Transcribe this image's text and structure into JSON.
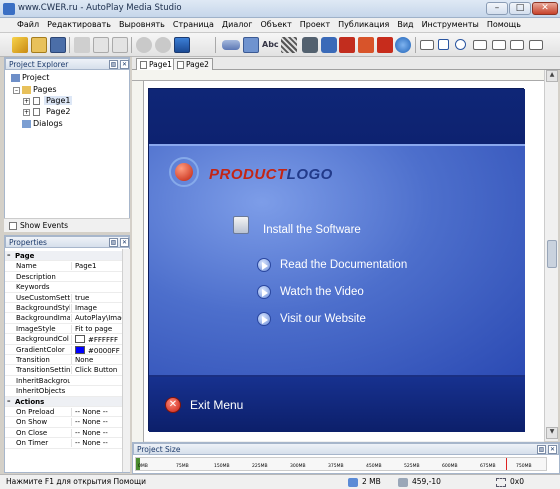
{
  "window": {
    "title": "www.CWER.ru - AutoPlay Media Studio"
  },
  "menu": [
    "Файл",
    "Редактировать",
    "Выровнять",
    "Страница",
    "Диалог",
    "Объект",
    "Проект",
    "Публикация",
    "Вид",
    "Инструменты",
    "Помощь"
  ],
  "explorer": {
    "title": "Project Explorer",
    "items": {
      "project": "Project",
      "pages": "Pages",
      "page1": "Page1",
      "page2": "Page2",
      "dialogs": "Dialogs"
    },
    "show_events": "Show Events"
  },
  "properties": {
    "title": "Properties",
    "section_page": "Page",
    "rows": [
      {
        "k": "Name",
        "v": "Page1"
      },
      {
        "k": "Description",
        "v": ""
      },
      {
        "k": "Keywords",
        "v": ""
      },
      {
        "k": "UseCustomSett",
        "v": "true"
      },
      {
        "k": "BackgroundStyl",
        "v": "Image"
      },
      {
        "k": "BackgroundIma",
        "v": "AutoPlay\\Imag"
      },
      {
        "k": "ImageStyle",
        "v": "Fit to page"
      },
      {
        "k": "BackgroundCol",
        "v": "#FFFFFF"
      },
      {
        "k": "GradientColor",
        "v": "#0000FF"
      },
      {
        "k": "Transition",
        "v": "None"
      },
      {
        "k": "TransitionSettin",
        "v": "Click Button"
      },
      {
        "k": "InheritBackgrou",
        "v": ""
      },
      {
        "k": "InheritObjects",
        "v": ""
      }
    ],
    "section_actions": "Actions",
    "actions": [
      {
        "k": "On Preload",
        "v": "-- None --"
      },
      {
        "k": "On Show",
        "v": "-- None --"
      },
      {
        "k": "On Close",
        "v": "-- None --"
      },
      {
        "k": "On Timer",
        "v": "-- None --"
      }
    ],
    "colors": {
      "background": "#FFFFFF",
      "gradient": "#0000FF"
    }
  },
  "tabs": [
    "Page1",
    "Page2"
  ],
  "page_content": {
    "logo_a": "PRODUCT",
    "logo_b": "LOGO",
    "install": "Install the Software",
    "items": [
      "Read the Documentation",
      "Watch the Video",
      "Visit our Website"
    ],
    "exit": "Exit Menu"
  },
  "project_size": {
    "title": "Project Size",
    "ticks": [
      "0MB",
      "75MB",
      "150MB",
      "225MB",
      "300MB",
      "375MB",
      "450MB",
      "525MB",
      "600MB",
      "675MB",
      "750MB"
    ]
  },
  "status": {
    "hint": "Нажмите F1 для открытия Помощи",
    "size": "2 MB",
    "coords": "459,-10",
    "sel": "0x0"
  }
}
